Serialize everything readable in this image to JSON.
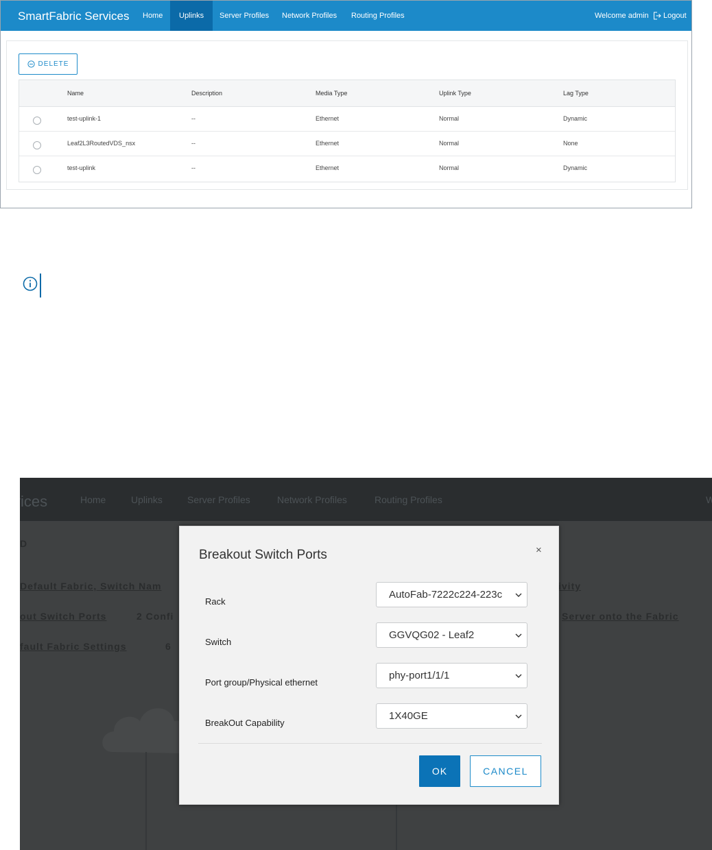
{
  "top": {
    "brand": "SmartFabric Services",
    "nav": [
      "Home",
      "Uplinks",
      "Server Profiles",
      "Network Profiles",
      "Routing Profiles"
    ],
    "active_tab": "Uplinks",
    "welcome": "Welcome admin",
    "logout": "Logout",
    "delete_label": "DELETE",
    "columns": [
      "Name",
      "Description",
      "Media Type",
      "Uplink Type",
      "Lag Type"
    ],
    "rows": [
      [
        "test-uplink-1",
        "--",
        "Ethernet",
        "Normal",
        "Dynamic"
      ],
      [
        "Leaf2L3RoutedVDS_nsx",
        "--",
        "Ethernet",
        "Normal",
        "None"
      ],
      [
        "test-uplink",
        "--",
        "Ethernet",
        "Normal",
        "Dynamic"
      ]
    ]
  },
  "note": {
    "icon": "info-icon"
  },
  "bottom": {
    "background": {
      "brand_fragment": "vices",
      "nav": [
        "Home",
        "Uplinks",
        "Server Profiles",
        "Network Profiles",
        "Routing Profiles"
      ],
      "nav_end_fragment": "W",
      "snippets": [
        "D",
        "Default Fabric, Switch Nam",
        "ivity",
        "out Switch Ports",
        "2 Confi",
        "Server onto the Fabric",
        "fault Fabric Settings",
        "6"
      ]
    },
    "modal": {
      "title": "Breakout Switch Ports",
      "close": "×",
      "fields": [
        {
          "label": "Rack",
          "value": "AutoFab-7222c224-223c"
        },
        {
          "label": "Switch",
          "value": "GGVQG02 - Leaf2"
        },
        {
          "label": "Port group/Physical ethernet",
          "value": "phy-port1/1/1"
        },
        {
          "label": "BreakOut Capability",
          "value": "1X40GE"
        }
      ],
      "ok": "OK",
      "cancel": "CANCEL"
    }
  }
}
